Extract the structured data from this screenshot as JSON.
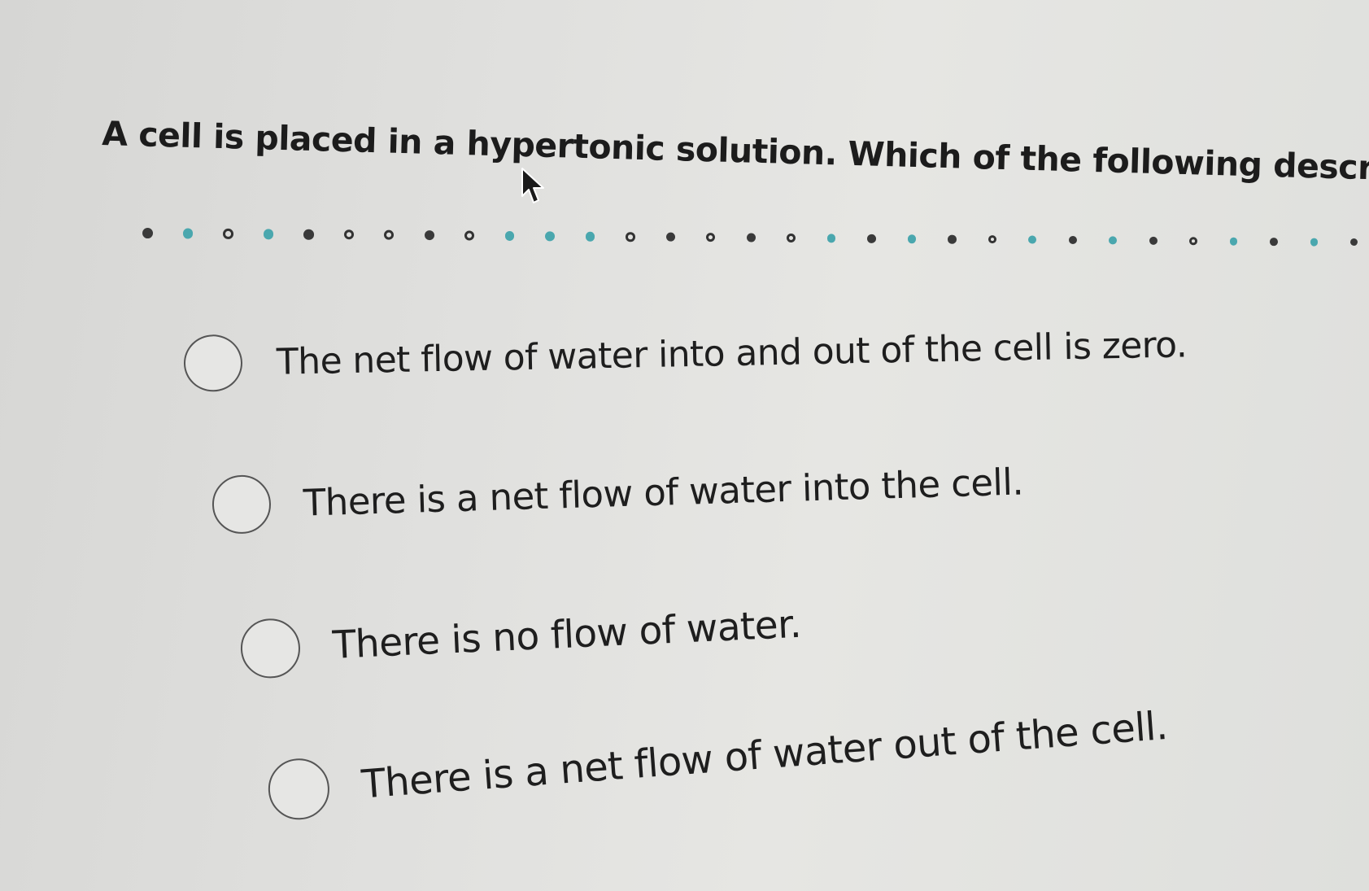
{
  "question": {
    "text": "A cell is placed in a hypertonic solution. Which of the following describes the resulting osmos"
  },
  "icons": {
    "cursor": "mouse-pointer-arrow-icon",
    "radio": "radio-unchecked-icon"
  },
  "colors": {
    "background": "#e0e0de",
    "dot_dark": "#3a3a3a",
    "dot_teal": "#4aa7ae",
    "text": "#1c1c1c"
  },
  "separator_dots": [
    "filled",
    "teal",
    "ring",
    "teal",
    "filled",
    "ring",
    "ring",
    "filled",
    "ring",
    "teal",
    "teal",
    "teal",
    "ring",
    "filled",
    "ring",
    "filled",
    "ring",
    "teal",
    "filled",
    "teal",
    "filled",
    "ring",
    "teal",
    "filled",
    "teal",
    "filled",
    "ring",
    "teal",
    "filled",
    "teal",
    "filled"
  ],
  "options": [
    {
      "label": "The net flow of water into and out of the cell is zero.",
      "selected": false
    },
    {
      "label": "There is a net flow of water into the cell.",
      "selected": false
    },
    {
      "label": "There is no flow of water.",
      "selected": false
    },
    {
      "label": "There is a net flow of water out of the cell.",
      "selected": false
    }
  ]
}
